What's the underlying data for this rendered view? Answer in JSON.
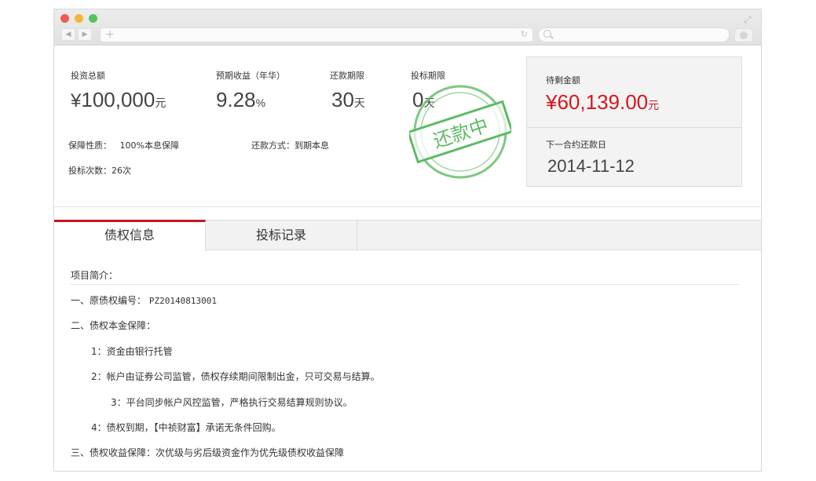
{
  "browser": {
    "url": "",
    "search": ""
  },
  "summary": {
    "invest_total": {
      "label": "投资总额",
      "currency": "¥",
      "value": "100,000",
      "unit": "元"
    },
    "expected_return": {
      "label": "预期收益（年华）",
      "value": "9.28",
      "unit": "%"
    },
    "repay_term": {
      "label": "还款期限",
      "value": "30",
      "unit": "天"
    },
    "bid_term": {
      "label": "投标期限",
      "value": "0",
      "unit": "天"
    },
    "guarantee": {
      "label": "保障性质：",
      "value": "100%本息保障"
    },
    "repay_method": {
      "label": "还款方式：",
      "value": "到期本息"
    },
    "bid_count": {
      "label": "投标次数：",
      "value": "26次"
    }
  },
  "stamp": {
    "text": "还款中",
    "color": "#5dbb63"
  },
  "panel": {
    "remaining_label": "待剩金额",
    "remaining_currency": "¥",
    "remaining_value": "60,139.00",
    "remaining_unit": "元",
    "next_date_label": "下一合约还款日",
    "next_date": "2014-11-12",
    "accent_color": "#d9151d"
  },
  "tabs": [
    {
      "label": "债权信息",
      "active": true
    },
    {
      "label": "投标记录",
      "active": false
    }
  ],
  "details": {
    "heading": "项目简介：",
    "line1_prefix": "一、原债权编号：",
    "line1_code": "PZ20140813001",
    "line2": "二、债权本金保障：",
    "item1": "1：资金由银行托管",
    "item2": "2：帐户由证券公司监管，债权存续期间限制出金，只可交易与结算。",
    "item3": "3：平台同步帐户风控监管，严格执行交易结算规则协议。",
    "item4": "4：债权到期，【中祯财富】承诺无条件回购。",
    "line3": "三、债权收益保障：次优级与劣后级资金作为优先级债权收益保障"
  }
}
